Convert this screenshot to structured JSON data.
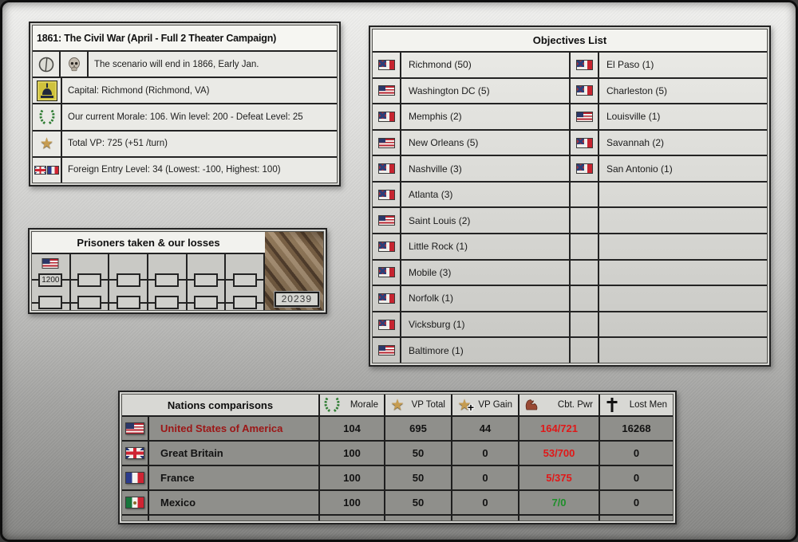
{
  "scenario": {
    "title": "1861: The Civil War (April - Full 2 Theater Campaign)",
    "rows": [
      {
        "icons": [
          "clock-icon",
          "skull-icon"
        ],
        "text": "The scenario will end in 1866, Early Jan."
      },
      {
        "icons": [
          "capitol-icon"
        ],
        "text": "Capital: Richmond (Richmond, VA)"
      },
      {
        "icons": [
          "wreath-icon"
        ],
        "text": "Our current Morale: 106. Win level: 200 - Defeat Level: 25"
      },
      {
        "icons": [
          "star-icon"
        ],
        "text": "Total VP: 725 (+51 /turn)"
      },
      {
        "icons": [
          "uk-fr-flags-icon"
        ],
        "text": "Foreign Entry Level: 34  (Lowest: -100, Highest: 100)"
      }
    ]
  },
  "prisoners": {
    "title": "Prisoners taken & our losses",
    "columns": [
      {
        "flag": "us",
        "value": "1200"
      },
      {
        "flag": "",
        "value": ""
      },
      {
        "flag": "",
        "value": ""
      },
      {
        "flag": "",
        "value": ""
      },
      {
        "flag": "",
        "value": ""
      },
      {
        "flag": "",
        "value": ""
      }
    ],
    "losses_value": "20239"
  },
  "objectives": {
    "title": "Objectives List",
    "rows": [
      {
        "l_flag": "csa",
        "l_name": "Richmond (50)",
        "r_flag": "csa",
        "r_name": "El Paso (1)"
      },
      {
        "l_flag": "us",
        "l_name": "Washington DC (5)",
        "r_flag": "csa",
        "r_name": "Charleston (5)"
      },
      {
        "l_flag": "csa",
        "l_name": "Memphis (2)",
        "r_flag": "us",
        "r_name": "Louisville (1)"
      },
      {
        "l_flag": "us",
        "l_name": "New Orleans (5)",
        "r_flag": "csa",
        "r_name": "Savannah (2)"
      },
      {
        "l_flag": "csa",
        "l_name": "Nashville (3)",
        "r_flag": "csa",
        "r_name": "San Antonio (1)"
      },
      {
        "l_flag": "csa",
        "l_name": "Atlanta (3)",
        "r_flag": "",
        "r_name": ""
      },
      {
        "l_flag": "us",
        "l_name": "Saint Louis (2)",
        "r_flag": "",
        "r_name": ""
      },
      {
        "l_flag": "csa",
        "l_name": "Little Rock (1)",
        "r_flag": "",
        "r_name": ""
      },
      {
        "l_flag": "csa",
        "l_name": "Mobile (3)",
        "r_flag": "",
        "r_name": ""
      },
      {
        "l_flag": "csa",
        "l_name": "Norfolk (1)",
        "r_flag": "",
        "r_name": ""
      },
      {
        "l_flag": "csa",
        "l_name": "Vicksburg (1)",
        "r_flag": "",
        "r_name": ""
      },
      {
        "l_flag": "us",
        "l_name": "Baltimore (1)",
        "r_flag": "",
        "r_name": ""
      }
    ]
  },
  "nations": {
    "title": "Nations comparisons",
    "columns": [
      {
        "icon": "wreath-icon",
        "label": "Morale"
      },
      {
        "icon": "star-icon",
        "label": "VP Total"
      },
      {
        "icon": "star-plus-icon",
        "label": "VP Gain"
      },
      {
        "icon": "bicep-icon",
        "label": "Cbt. Pwr"
      },
      {
        "icon": "cross-icon",
        "label": "Lost Men"
      }
    ],
    "rows": [
      {
        "flag": "us",
        "name": "United States of America",
        "name_color": "#9c1616",
        "morale": "104",
        "vp_total": "695",
        "vp_gain": "44",
        "cbt_pwr": "164/721",
        "cbt_color": "#e01818",
        "lost_men": "16268"
      },
      {
        "flag": "uk",
        "name": "Great Britain",
        "name_color": "#121212",
        "morale": "100",
        "vp_total": "50",
        "vp_gain": "0",
        "cbt_pwr": "53/700",
        "cbt_color": "#e01818",
        "lost_men": "0"
      },
      {
        "flag": "fr",
        "name": "France",
        "name_color": "#121212",
        "morale": "100",
        "vp_total": "50",
        "vp_gain": "0",
        "cbt_pwr": "5/375",
        "cbt_color": "#e01818",
        "lost_men": "0"
      },
      {
        "flag": "mx",
        "name": "Mexico",
        "name_color": "#121212",
        "morale": "100",
        "vp_total": "50",
        "vp_gain": "0",
        "cbt_pwr": "7/0",
        "cbt_color": "#1f8f2a",
        "lost_men": "0"
      }
    ]
  },
  "colors": {
    "combat_power_red": "#e01818",
    "combat_power_green": "#1f8f2a",
    "usa_name_red": "#9c1616",
    "panel_border": "#232323"
  }
}
